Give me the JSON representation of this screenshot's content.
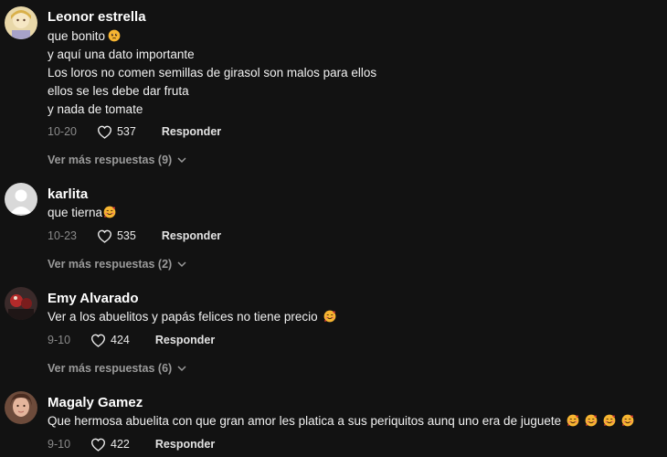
{
  "comments": [
    {
      "username": "Leonor estrella",
      "lines": [
        "que bonito",
        "y aquí una dato importante",
        "Los loros no comen semillas de girasol son malos para ellos",
        "ellos se les debe dar fruta",
        "y nada de tomate"
      ],
      "date": "10-20",
      "likes": "537",
      "reply_label": "Responder",
      "more_replies": "Ver más respuestas (9)"
    },
    {
      "username": "karlita",
      "lines": [
        "que tierna"
      ],
      "date": "10-23",
      "likes": "535",
      "reply_label": "Responder",
      "more_replies": "Ver más respuestas (2)"
    },
    {
      "username": "Emy Alvarado",
      "lines": [
        "Ver a los abuelitos y papás felices no tiene precio"
      ],
      "date": "9-10",
      "likes": "424",
      "reply_label": "Responder",
      "more_replies": "Ver más respuestas (6)"
    },
    {
      "username": "Magaly Gamez",
      "lines": [
        "Que hermosa abuelita con que gran amor les platica a sus periquitos aunq uno era de juguete"
      ],
      "date": "9-10",
      "likes": "422",
      "reply_label": "Responder"
    }
  ],
  "icons": {
    "like": "heart-outline-icon",
    "expand": "chevron-down-icon",
    "emoji_sad": "pleading-face-emoji",
    "emoji_love": "smiling-face-with-hearts-emoji"
  },
  "colors": {
    "background": "#121212",
    "username": "#ffffff",
    "meta_gray": "#8a8a8a",
    "emoji_yellow": "#f7b531"
  }
}
